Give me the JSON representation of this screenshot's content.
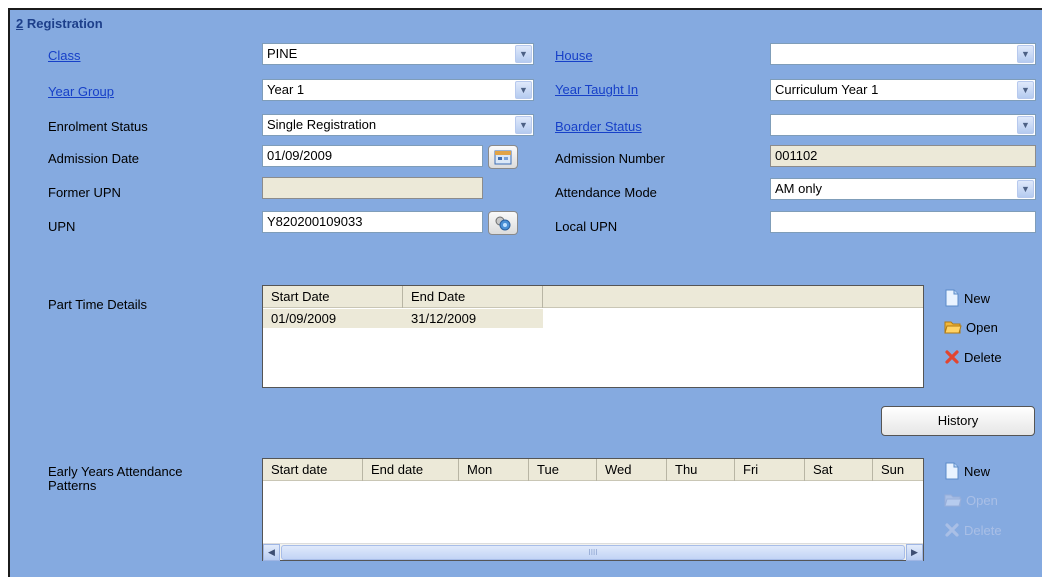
{
  "section": {
    "number": "2",
    "title": " Registration"
  },
  "fields": {
    "class": {
      "label": "Class",
      "value": "PINE"
    },
    "house": {
      "label": "House",
      "value": ""
    },
    "year_group": {
      "label": "Year Group",
      "value": "Year 1"
    },
    "year_taught_in": {
      "label": "Year Taught In",
      "value": "Curriculum Year 1"
    },
    "enrolment_status": {
      "label": "Enrolment Status",
      "value": "Single Registration"
    },
    "boarder_status": {
      "label": "Boarder Status",
      "value": ""
    },
    "admission_date": {
      "label": "Admission Date",
      "value": "01/09/2009"
    },
    "admission_number": {
      "label": "Admission Number",
      "value": "001102"
    },
    "former_upn": {
      "label": "Former UPN",
      "value": ""
    },
    "attendance_mode": {
      "label": "Attendance Mode",
      "value": "AM only"
    },
    "upn": {
      "label": "UPN",
      "value": "Y820200109033"
    },
    "local_upn": {
      "label": "Local UPN",
      "value": ""
    }
  },
  "part_time": {
    "label": "Part Time Details",
    "columns": [
      "Start Date",
      "End Date"
    ],
    "rows": [
      [
        "01/09/2009",
        "31/12/2009"
      ]
    ]
  },
  "part_time_actions": {
    "new": "New",
    "open": "Open",
    "delete": "Delete"
  },
  "history_label": "History",
  "early_years": {
    "label_line1": "Early Years Attendance",
    "label_line2": "Patterns",
    "columns": [
      "Start date",
      "End date",
      "Mon",
      "Tue",
      "Wed",
      "Thu",
      "Fri",
      "Sat",
      "Sun"
    ]
  },
  "early_years_actions": {
    "new": "New",
    "open": "Open",
    "delete": "Delete"
  },
  "scrollbar": {
    "grip": "IIII"
  },
  "colors": {
    "panel_bg": "#85aae0",
    "link": "#1740c8",
    "readonly_bg": "#ece9d8"
  },
  "icons": {
    "dropdown": "chevron-down-icon",
    "calendar": "calendar-icon",
    "lookup": "lookup-icon",
    "new": "new-document-icon",
    "open": "open-folder-icon",
    "delete": "delete-x-icon"
  }
}
